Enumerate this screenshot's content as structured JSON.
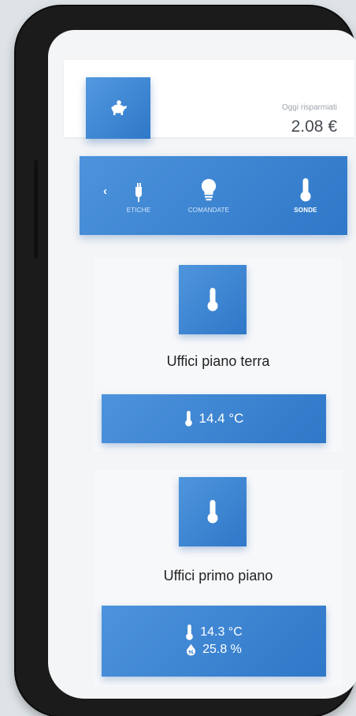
{
  "header": {
    "savings_label": "Oggi risparmiati",
    "savings_value": "2.08 €",
    "icon": "piggy-bank-icon"
  },
  "tabs": [
    {
      "label": "ETICHE",
      "icon": "plug-icon",
      "active": false
    },
    {
      "label": "COMANDATE",
      "icon": "lightbulb-icon",
      "active": false
    },
    {
      "label": "SONDE",
      "icon": "thermometer-icon",
      "active": true
    }
  ],
  "sensors": [
    {
      "name": "Uffici piano terra",
      "icon": "thermometer-icon",
      "readings": [
        {
          "icon": "thermometer-icon",
          "value": "14.4 °C"
        }
      ]
    },
    {
      "name": "Uffici primo piano",
      "icon": "thermometer-icon",
      "readings": [
        {
          "icon": "thermometer-icon",
          "value": "14.3 °C"
        },
        {
          "icon": "humidity-drop-icon",
          "value": "25.8 %"
        }
      ]
    }
  ],
  "colors": {
    "accent": "#2f78c8",
    "accent_light": "#5299e0",
    "background": "#f4f5f7",
    "device": "#1b1b1b"
  }
}
